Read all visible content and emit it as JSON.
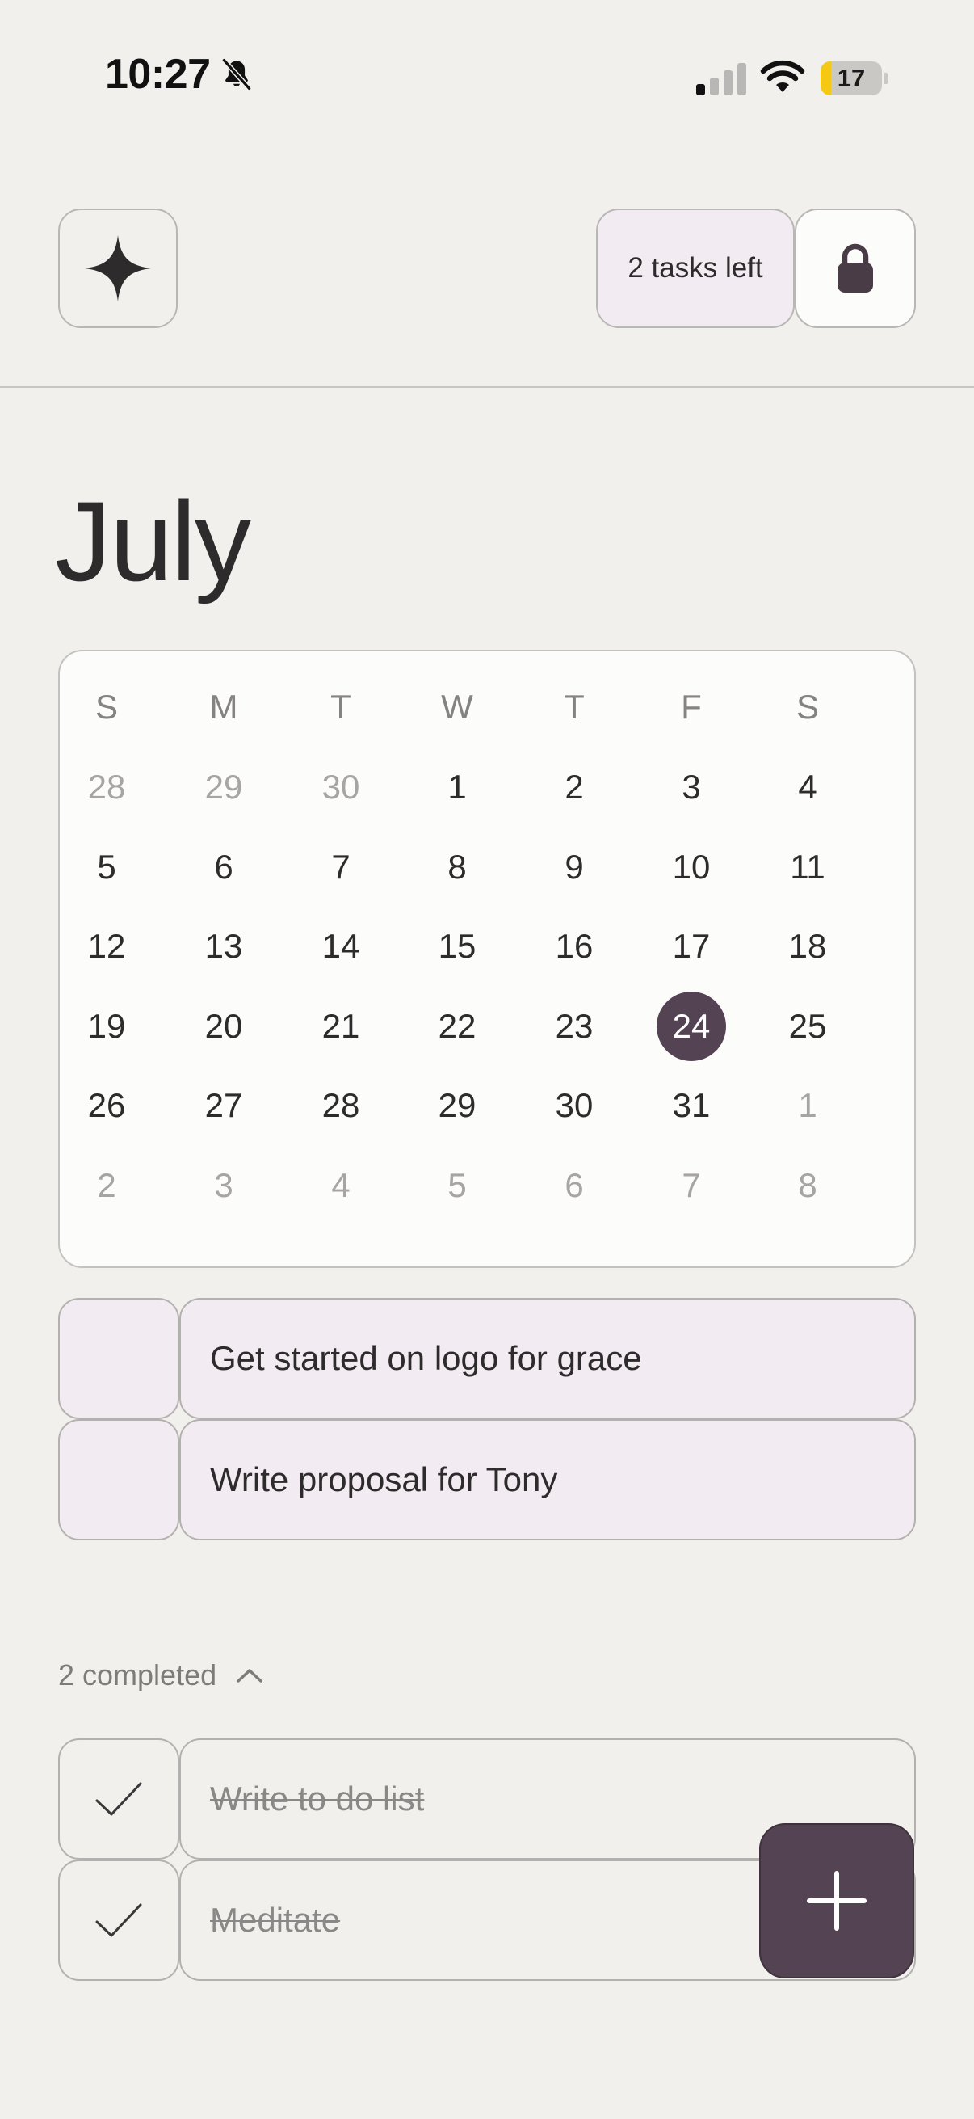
{
  "status_bar": {
    "time": "10:27",
    "battery_level": 17,
    "battery_text": "17",
    "icons": [
      "bell-slash-icon",
      "cellular-signal-icon",
      "wifi-icon",
      "battery-icon"
    ]
  },
  "toolbar": {
    "sparkle_icon": "sparkle-icon",
    "tasks_left_label": "2 tasks left",
    "lock_icon": "lock-icon"
  },
  "calendar": {
    "month": "July",
    "weekdays": [
      "S",
      "M",
      "T",
      "W",
      "T",
      "F",
      "S"
    ],
    "weeks": [
      [
        "28",
        "29",
        "30",
        "1",
        "2",
        "3",
        "4"
      ],
      [
        "5",
        "6",
        "7",
        "8",
        "9",
        "10",
        "11"
      ],
      [
        "12",
        "13",
        "14",
        "15",
        "16",
        "17",
        "18"
      ],
      [
        "19",
        "20",
        "21",
        "22",
        "23",
        "24",
        "25"
      ],
      [
        "26",
        "27",
        "28",
        "29",
        "30",
        "31",
        "1"
      ],
      [
        "2",
        "3",
        "4",
        "5",
        "6",
        "7",
        "8"
      ]
    ],
    "outside_month": [
      [
        0,
        0
      ],
      [
        0,
        1
      ],
      [
        0,
        2
      ],
      [
        4,
        6
      ],
      [
        5,
        0
      ],
      [
        5,
        1
      ],
      [
        5,
        2
      ],
      [
        5,
        3
      ],
      [
        5,
        4
      ],
      [
        5,
        5
      ],
      [
        5,
        6
      ]
    ],
    "selected_day": "24",
    "selected_color": "#544352"
  },
  "tasks": {
    "pending": [
      {
        "title": "Get started on logo for grace"
      },
      {
        "title": "Write proposal for Tony"
      }
    ],
    "completed_label": "2 completed",
    "completed": [
      {
        "title": "Write to do list"
      },
      {
        "title": "Meditate"
      }
    ]
  },
  "fab": {
    "icon": "plus-icon"
  },
  "colors": {
    "background": "#f1f0ec",
    "pending_fill": "#f2ebf1",
    "accent": "#544352",
    "battery_yellow": "#f5c814"
  }
}
